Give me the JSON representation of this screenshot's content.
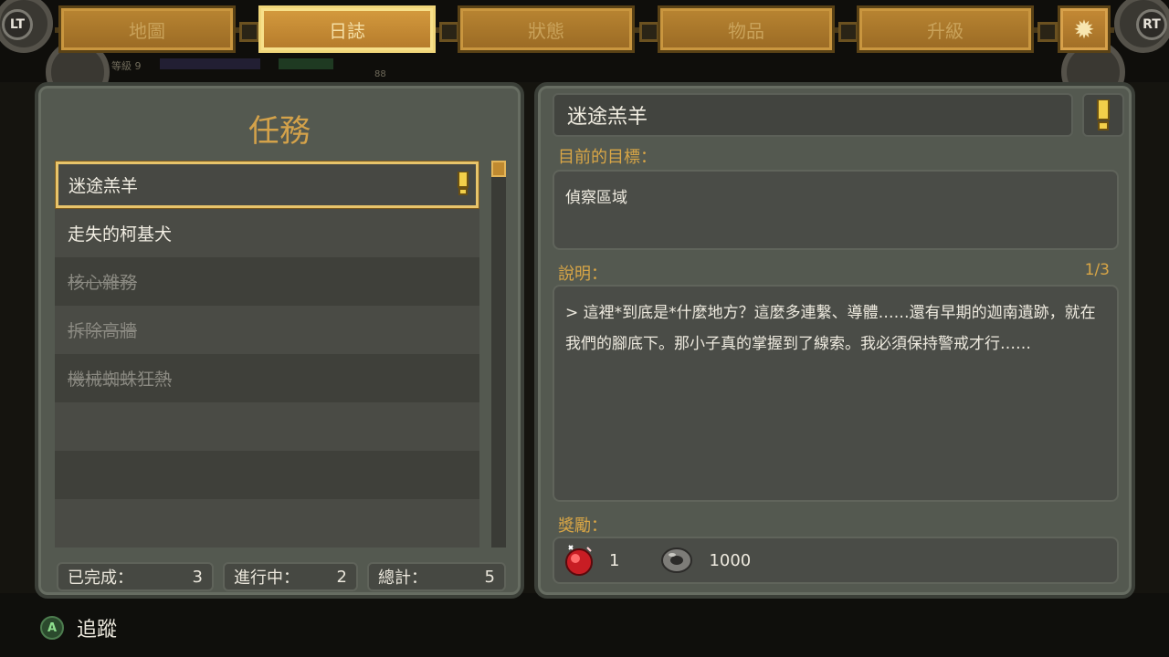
{
  "nav": {
    "left_button": "LT",
    "right_button": "RT",
    "tabs": [
      {
        "label": "地圖",
        "active": false
      },
      {
        "label": "日誌",
        "active": true
      },
      {
        "label": "狀態",
        "active": false
      },
      {
        "label": "物品",
        "active": false
      },
      {
        "label": "升級",
        "active": false
      }
    ],
    "settings_icon": "gear-icon"
  },
  "hud": {
    "level_text": "等級 9",
    "hud_value": "88"
  },
  "quest_panel": {
    "title": "任務",
    "quests": [
      {
        "name": "迷途羔羊",
        "status": "selected",
        "tracked": true
      },
      {
        "name": "走失的柯基犬",
        "status": "active"
      },
      {
        "name": "核心雜務",
        "status": "completed"
      },
      {
        "name": "拆除高牆",
        "status": "completed"
      },
      {
        "name": "機械蜘蛛狂熱",
        "status": "completed"
      }
    ],
    "stats": {
      "completed_label": "已完成：",
      "completed_value": "3",
      "in_progress_label": "進行中：",
      "in_progress_value": "2",
      "total_label": "總計：",
      "total_value": "5"
    }
  },
  "detail_panel": {
    "quest_title": "迷途羔羊",
    "objective_label": "目前的目標：",
    "objective_text": "偵察區域",
    "description_label": "說明：",
    "page_indicator": "1/3",
    "description_text": "> 這裡*到底是*什麼地方？這麼多連繫、導體……還有早期的迦南遺跡，就在我們的腳底下。那小子真的掌握到了線索。我必須保持警戒才行……",
    "reward_label": "獎勵：",
    "rewards": [
      {
        "icon": "red-gem-icon",
        "value": "1"
      },
      {
        "icon": "gear-part-icon",
        "value": "1000"
      }
    ]
  },
  "footer": {
    "button_glyph": "A",
    "track_label": "追蹤"
  },
  "colors": {
    "accent_gold": "#d4a24a",
    "panel": "#545950",
    "selection": "#e8c46a"
  }
}
